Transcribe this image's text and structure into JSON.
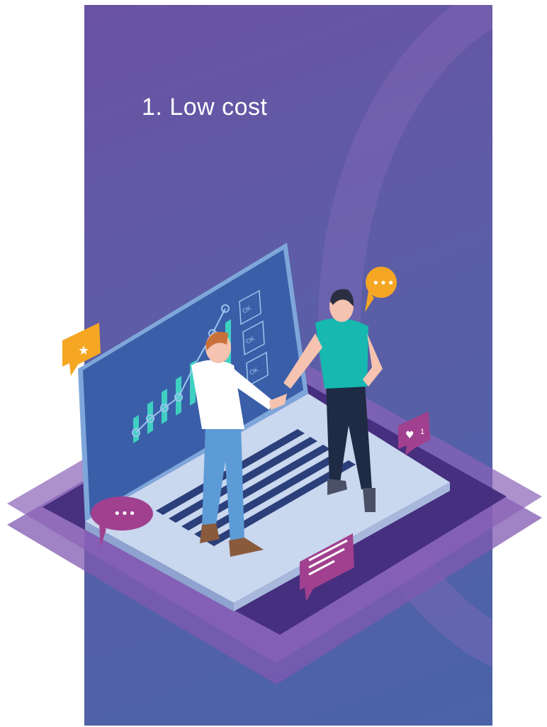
{
  "heading": {
    "title": "1. Low cost"
  },
  "screen": {
    "ok_labels": [
      "OK",
      "OK",
      "OK"
    ]
  },
  "bubbles": {
    "like_count": "1"
  },
  "colors": {
    "card_top": "#6a52a3",
    "card_bottom": "#4a63a8",
    "accent_orange": "#f5a623",
    "accent_pink": "#a0408f",
    "teal": "#16b8b0"
  },
  "icons": [
    "star-icon",
    "chat-dots-icon",
    "heart-icon",
    "message-lines-icon"
  ]
}
